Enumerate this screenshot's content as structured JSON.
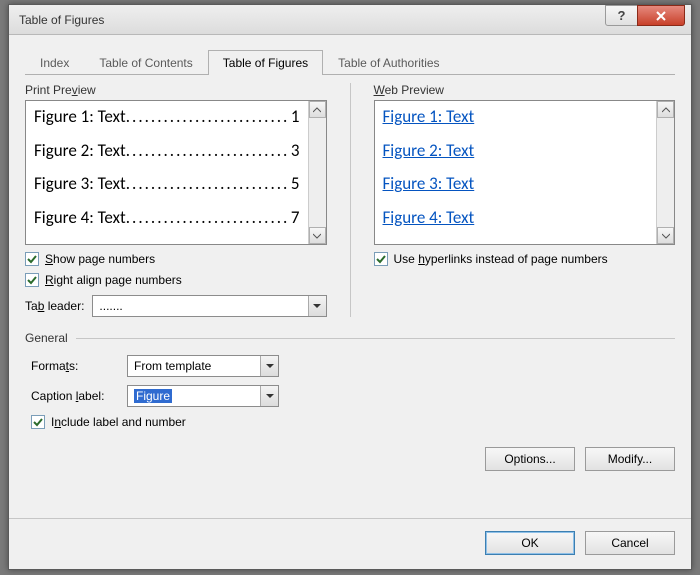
{
  "dialog": {
    "title": "Table of Figures"
  },
  "tabs": {
    "index": "Index",
    "toc": "Table of Contents",
    "tof": "Table of Figures",
    "toa": "Table of Authorities"
  },
  "print_preview": {
    "label": "Print Preview",
    "rows": [
      {
        "label": "Figure 1: Text",
        "page": "1"
      },
      {
        "label": "Figure 2: Text",
        "page": "3"
      },
      {
        "label": "Figure 3: Text",
        "page": "5"
      },
      {
        "label": "Figure 4: Text",
        "page": "7"
      }
    ]
  },
  "web_preview": {
    "label": "Web Preview",
    "rows": [
      {
        "label": "Figure 1: Text"
      },
      {
        "label": "Figure 2: Text"
      },
      {
        "label": "Figure 3: Text"
      },
      {
        "label": "Figure 4: Text"
      }
    ]
  },
  "options_left": {
    "show_page_numbers": "Show page numbers",
    "right_align": "Right align page numbers",
    "tab_leader_label": "Tab leader:",
    "tab_leader_value": "......."
  },
  "options_right": {
    "use_hyperlinks": "Use hyperlinks instead of page numbers"
  },
  "general": {
    "header": "General",
    "formats_label": "Formats:",
    "formats_value": "From template",
    "caption_label": "Caption label:",
    "caption_value": "Figure",
    "include_label": "Include label and number"
  },
  "buttons": {
    "options": "Options...",
    "modify": "Modify...",
    "ok": "OK",
    "cancel": "Cancel"
  }
}
